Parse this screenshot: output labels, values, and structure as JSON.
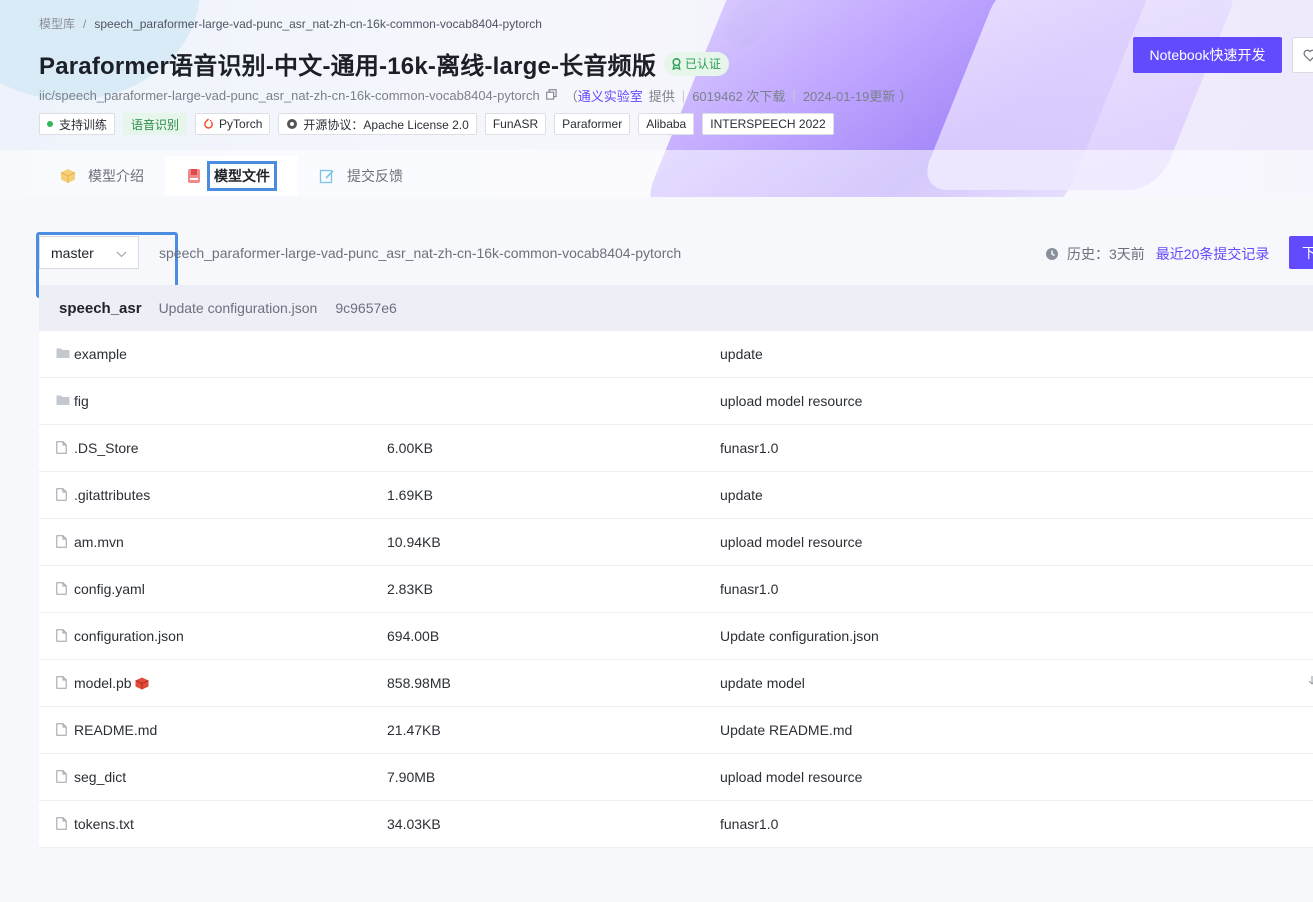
{
  "breadcrumb": {
    "root": "模型库",
    "separator": "/",
    "current": "speech_paraformer-large-vad-punc_asr_nat-zh-cn-16k-common-vocab8404-pytorch"
  },
  "header": {
    "title": "Paraformer语音识别-中文-通用-16k-离线-large-长音频版",
    "verified_label": "已认证",
    "notebook_button": "Notebook快速开发",
    "model_id": "iic/speech_paraformer-large-vad-punc_asr_nat-zh-cn-16k-common-vocab8404-pytorch",
    "meta_open": "（",
    "provider": "通义实验室",
    "provided_label": "提供",
    "downloads": "6019462 次下载",
    "updated": "2024-01-19更新",
    "meta_close": "）"
  },
  "tags": {
    "train": "支持训练",
    "task": "语音识别",
    "framework": "PyTorch",
    "license": "开源协议：Apache License 2.0",
    "t5": "FunASR",
    "t6": "Paraformer",
    "t7": "Alibaba",
    "t8": "INTERSPEECH 2022"
  },
  "tabs": {
    "intro": "模型介绍",
    "files": "模型文件",
    "feedback": "提交反馈",
    "active": "files"
  },
  "toolbar": {
    "branch": "master",
    "path": "speech_paraformer-large-vad-punc_asr_nat-zh-cn-16k-common-vocab8404-pytorch",
    "history_label": "历史：3天前",
    "recent_commits": "最近20条提交记录",
    "download_label": "下"
  },
  "commit": {
    "repo": "speech_asr",
    "message": "Update configuration.json",
    "hash": "9c9657e6"
  },
  "files": [
    {
      "name": "example",
      "size": "",
      "message": "update",
      "type": "folder"
    },
    {
      "name": "fig",
      "size": "",
      "message": "upload model resource",
      "type": "folder"
    },
    {
      "name": ".DS_Store",
      "size": "6.00KB",
      "message": "funasr1.0",
      "type": "file"
    },
    {
      "name": ".gitattributes",
      "size": "1.69KB",
      "message": "update",
      "type": "file"
    },
    {
      "name": "am.mvn",
      "size": "10.94KB",
      "message": "upload model resource",
      "type": "file"
    },
    {
      "name": "config.yaml",
      "size": "2.83KB",
      "message": "funasr1.0",
      "type": "file"
    },
    {
      "name": "configuration.json",
      "size": "694.00B",
      "message": "Update configuration.json",
      "type": "file"
    },
    {
      "name": "model.pb",
      "size": "858.98MB",
      "message": "update model",
      "type": "file",
      "lfs": true
    },
    {
      "name": "README.md",
      "size": "21.47KB",
      "message": "Update README.md",
      "type": "file"
    },
    {
      "name": "seg_dict",
      "size": "7.90MB",
      "message": "upload model resource",
      "type": "file"
    },
    {
      "name": "tokens.txt",
      "size": "34.03KB",
      "message": "funasr1.0",
      "type": "file"
    }
  ],
  "colors": {
    "accent": "#624aff",
    "highlight_border": "#4b8de0",
    "verified_green": "#2f9e55"
  }
}
